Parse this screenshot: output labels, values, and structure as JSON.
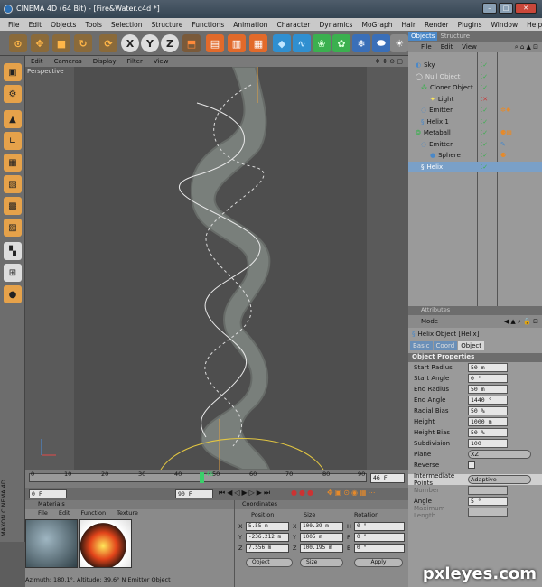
{
  "window": {
    "title": "CINEMA 4D (64 Bit) - [Fire&Water.c4d *]"
  },
  "menu": [
    "File",
    "Edit",
    "Objects",
    "Tools",
    "Selection",
    "Structure",
    "Functions",
    "Animation",
    "Character",
    "Dynamics",
    "MoGraph",
    "Hair",
    "Render",
    "Plugins",
    "Window",
    "Help"
  ],
  "toolbar_axes": [
    "X",
    "Y",
    "Z"
  ],
  "viewport": {
    "menu": [
      "Edit",
      "Cameras",
      "Display",
      "Filter",
      "View"
    ],
    "label": "Perspective"
  },
  "timeline": {
    "ticks": [
      "0",
      "10",
      "20",
      "30",
      "40",
      "50",
      "60",
      "70",
      "80",
      "90"
    ],
    "current_frame": "46",
    "frame_field": "46 F"
  },
  "playback": {
    "start": "0 F",
    "end": "90 F"
  },
  "materials": {
    "title": "Materials",
    "menu": [
      "File",
      "Edit",
      "Function",
      "Texture"
    ]
  },
  "coordinates": {
    "title": "Coordinates",
    "headers": [
      "Position",
      "Size",
      "Rotation"
    ],
    "rows": [
      {
        "axis": "X",
        "pos": "5.55 m",
        "size": "100.39 m",
        "rlabel": "H",
        "rot": "0 °"
      },
      {
        "axis": "Y",
        "pos": "-236.212 m",
        "size": "1005 m",
        "rlabel": "P",
        "rot": "0 °"
      },
      {
        "axis": "Z",
        "pos": "7.556 m",
        "size": "100.195 m",
        "rlabel": "B",
        "rot": "0 °"
      }
    ],
    "mode_object": "Object",
    "mode_size": "Size",
    "apply": "Apply"
  },
  "status": "Azimuth: 180.1°, Altitude: 39.6°  N    Emitter Object",
  "brand": "MAXON CINEMA 4D",
  "objects": {
    "tabs": [
      "Objects",
      "Structure"
    ],
    "menu": [
      "File",
      "Edit",
      "View"
    ],
    "items": [
      {
        "name": "Sky",
        "indent": 0
      },
      {
        "name": "Null Object",
        "indent": 0
      },
      {
        "name": "Cloner Object",
        "indent": 1
      },
      {
        "name": "Light",
        "indent": 2
      },
      {
        "name": "Emitter",
        "indent": 1
      },
      {
        "name": "Helix 1",
        "indent": 1
      },
      {
        "name": "Metaball",
        "indent": 0
      },
      {
        "name": "Emitter",
        "indent": 1
      },
      {
        "name": "Sphere",
        "indent": 2
      },
      {
        "name": "Helix",
        "indent": 1
      }
    ]
  },
  "attributes": {
    "title": "Attributes",
    "mode": "Mode",
    "object_title": "Helix Object [Helix]",
    "tabs": [
      "Basic",
      "Coord",
      "Object"
    ],
    "section": "Object Properties",
    "props": [
      {
        "label": "Start Radius",
        "value": "50 m"
      },
      {
        "label": "Start Angle",
        "value": "0 °"
      },
      {
        "label": "End Radius",
        "value": "50 m"
      },
      {
        "label": "End Angle",
        "value": "1440 °"
      },
      {
        "label": "Radial Bias",
        "value": "50 %"
      },
      {
        "label": "Height",
        "value": "1000 m"
      },
      {
        "label": "Height Bias",
        "value": "50 %"
      },
      {
        "label": "Subdivision",
        "value": "100"
      },
      {
        "label": "Plane",
        "value": "XZ"
      },
      {
        "label": "Reverse",
        "value": ""
      }
    ],
    "interp_label": "Intermediate Points",
    "interp_value": "Adaptive",
    "number": "Number",
    "angle": "Angle",
    "angle_value": "5 °",
    "maxlen": "Maximum Length"
  },
  "watermark": "pxleyes.com"
}
